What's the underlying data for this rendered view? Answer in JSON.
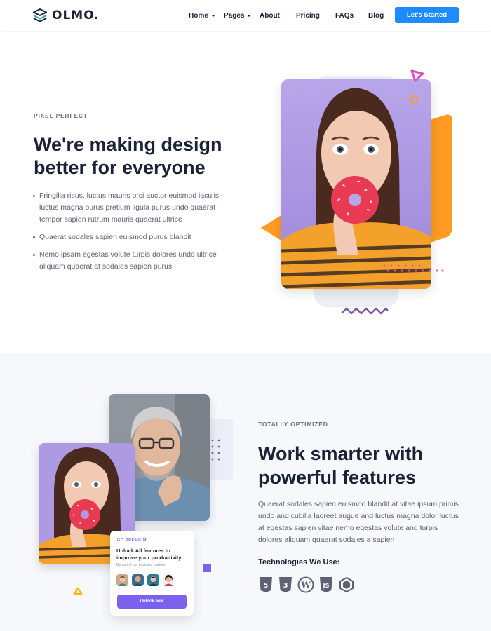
{
  "header": {
    "brand": "OLMO.",
    "nav": [
      {
        "label": "Home",
        "has_dropdown": true
      },
      {
        "label": "Pages",
        "has_dropdown": true
      },
      {
        "label": "About",
        "has_dropdown": false
      },
      {
        "label": "Pricing",
        "has_dropdown": false
      },
      {
        "label": "FAQs",
        "has_dropdown": false
      },
      {
        "label": "Blog",
        "has_dropdown": false
      }
    ],
    "cta_label": "Let's Started"
  },
  "hero": {
    "eyebrow": "PIXEL PERFECT",
    "title": "We're making design better for everyone",
    "bullets": [
      "Fringilla risus, luctus mauris orci auctor euismod iaculis luctus magna purus pretium ligula purus undo quaerat tempor sapien rutrum mauris quaerat ultrice",
      "Quaerat sodales sapien euismod purus blandit",
      "Nemo ipsam egestas volute turpis dolores undo ultrice aliquam quaerat at sodales sapien purus"
    ]
  },
  "features": {
    "eyebrow": "TOTALLY OPTIMIZED",
    "title": "Work smarter with powerful features",
    "paragraph": "Quaerat sodales sapien euismod blandit at vitae ipsum primis undo and cubilia laoreet augue and luctus magna dolor luctus at egestas sapien vitae nemo egestas volute and turpis dolores aliquam quaerat sodales a sapien",
    "tech_title": "Technologies We Use:",
    "tech_icons": [
      "html5-icon",
      "css3-icon",
      "wordpress-icon",
      "javascript-icon",
      "box-icon"
    ]
  },
  "promo_card": {
    "eyebrow": "GO PREMIUM",
    "title": "Unlock All features to improve your productivity",
    "subtitle": "Be part of our business platform",
    "button_label": "Unlock now"
  },
  "colors": {
    "primary_blue": "#1e8cff",
    "accent_purple": "#7b61f0",
    "accent_orange": "#ff9b23",
    "accent_pink": "#d94fc0",
    "heading": "#1b2236",
    "body_text": "#5d6272"
  }
}
